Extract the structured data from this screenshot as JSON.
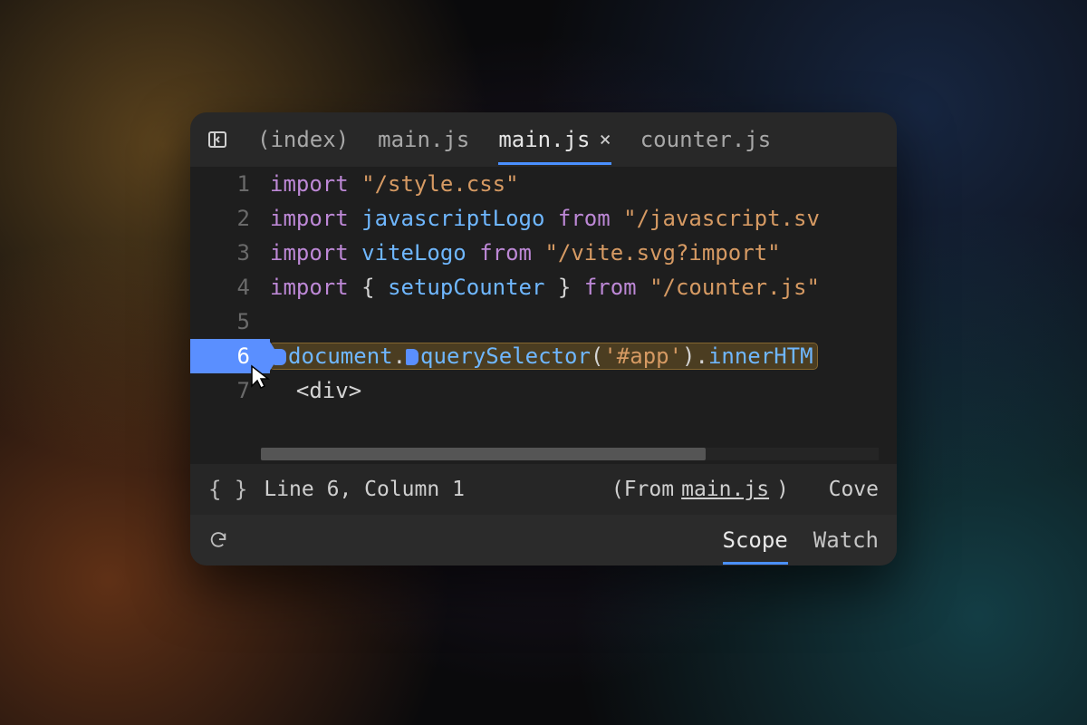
{
  "tabs": {
    "items": [
      {
        "label": "(index)",
        "active": false
      },
      {
        "label": "main.js",
        "active": false
      },
      {
        "label": "main.js",
        "active": true
      },
      {
        "label": "counter.js",
        "active": false
      }
    ],
    "close_label": "×"
  },
  "code": {
    "lines": [
      {
        "n": "1",
        "tokens": [
          [
            "kw",
            "import "
          ],
          [
            "str",
            "\"/style.css\""
          ]
        ]
      },
      {
        "n": "2",
        "tokens": [
          [
            "kw",
            "import "
          ],
          [
            "id",
            "javascriptLogo "
          ],
          [
            "kw",
            "from "
          ],
          [
            "str",
            "\"/javascript.sv"
          ]
        ]
      },
      {
        "n": "3",
        "tokens": [
          [
            "kw",
            "import "
          ],
          [
            "id",
            "viteLogo "
          ],
          [
            "kw",
            "from "
          ],
          [
            "str",
            "\"/vite.svg?import\""
          ]
        ]
      },
      {
        "n": "4",
        "tokens": [
          [
            "kw",
            "import "
          ],
          [
            "pn",
            "{ "
          ],
          [
            "id",
            "setupCounter"
          ],
          [
            "pn",
            " } "
          ],
          [
            "kw",
            "from "
          ],
          [
            "str",
            "\"/counter.js\""
          ]
        ]
      },
      {
        "n": "5",
        "tokens": []
      },
      {
        "n": "6",
        "current": true,
        "tokens": [
          [
            "id",
            "document"
          ],
          [
            "pn",
            "."
          ],
          [
            "id",
            "querySelector"
          ],
          [
            "pn",
            "("
          ],
          [
            "str",
            "'#app'"
          ],
          [
            "pn",
            ")."
          ],
          [
            "id",
            "innerHTM"
          ]
        ]
      },
      {
        "n": "7",
        "tokens": [
          [
            "dim",
            "  "
          ],
          [
            "tag",
            "<div>"
          ]
        ]
      }
    ]
  },
  "status": {
    "position": "Line 6, Column 1",
    "from_prefix": "(From ",
    "from_file": "main.js",
    "from_suffix": ")",
    "coverage": "Cove"
  },
  "debug_tabs": {
    "scope": "Scope",
    "watch": "Watch"
  }
}
